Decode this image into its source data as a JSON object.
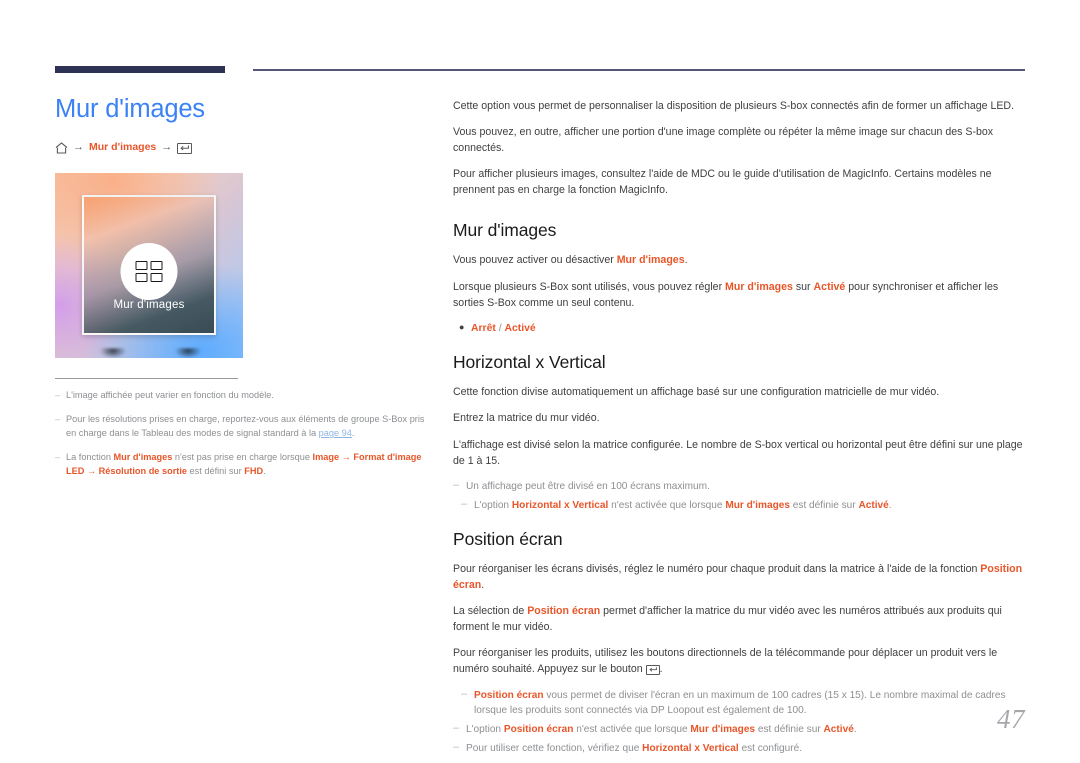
{
  "document": {
    "page_number": "47",
    "accent_color": "#e8562a",
    "title_color": "#3b82f6",
    "rule_color": "#2e3356"
  },
  "left": {
    "page_title": "Mur d'images",
    "breadcrumb": {
      "home_icon": "home-icon",
      "arrow": "→",
      "item": "Mur d'images",
      "enter_icon": "enter-key-icon"
    },
    "thumbnail": {
      "label": "Mur d'images",
      "icon": "four-panel-grid-icon"
    },
    "footnotes": [
      {
        "dash": "–",
        "parts": [
          {
            "text": "L'image affichée peut varier en fonction du modèle.",
            "style": "grey"
          }
        ]
      },
      {
        "dash": "–",
        "parts": [
          {
            "text": "Pour les résolutions prises en charge, reportez-vous aux éléments de groupe S-Box pris en charge dans le Tableau des modes de signal standard à la ",
            "style": "grey"
          },
          {
            "text": "page 94",
            "style": "link"
          },
          {
            "text": ".",
            "style": "grey"
          }
        ]
      },
      {
        "dash": "–",
        "parts": [
          {
            "text": "La fonction ",
            "style": "grey"
          },
          {
            "text": "Mur d'images",
            "style": "accent"
          },
          {
            "text": " n'est pas prise en charge lorsque ",
            "style": "grey"
          },
          {
            "text": "Image",
            "style": "accent"
          },
          {
            "text": " → ",
            "style": "accent"
          },
          {
            "text": "Format d'image LED",
            "style": "accent"
          },
          {
            "text": " → ",
            "style": "accent"
          },
          {
            "text": "Résolution de sortie",
            "style": "accent"
          },
          {
            "text": " est défini sur ",
            "style": "grey"
          },
          {
            "text": "FHD",
            "style": "accent"
          },
          {
            "text": ".",
            "style": "grey"
          }
        ]
      }
    ]
  },
  "right": {
    "intro_paragraphs": [
      "Cette option vous permet de personnaliser la disposition de plusieurs S-box connectés afin de former un affichage LED.",
      "Vous pouvez, en outre, afficher une portion d'une image complète ou répéter la même image sur chacun des S-box connectés.",
      "Pour afficher plusieurs images, consultez l'aide de MDC ou le guide d'utilisation de MagicInfo. Certains modèles ne prennent pas en charge la fonction MagicInfo."
    ],
    "sections": [
      {
        "heading": "Mur d'images",
        "paragraphs": [
          [
            {
              "text": "Vous pouvez activer ou désactiver ",
              "style": "body"
            },
            {
              "text": "Mur d'images",
              "style": "accent"
            },
            {
              "text": ".",
              "style": "body"
            }
          ],
          [
            {
              "text": "Lorsque plusieurs S-Box sont utilisés, vous pouvez régler ",
              "style": "body"
            },
            {
              "text": "Mur d'images",
              "style": "accent"
            },
            {
              "text": " sur ",
              "style": "body"
            },
            {
              "text": "Activé",
              "style": "accent"
            },
            {
              "text": " pour synchroniser et afficher les sorties S-Box comme un seul contenu.",
              "style": "body"
            }
          ]
        ],
        "bullets": [
          [
            {
              "text": "Arrêt",
              "style": "accent"
            },
            {
              "text": " / ",
              "style": "grey"
            },
            {
              "text": "Activé",
              "style": "accent"
            }
          ]
        ],
        "notes": []
      },
      {
        "heading": "Horizontal x Vertical",
        "paragraphs": [
          [
            {
              "text": "Cette fonction divise automatiquement un affichage basé sur une configuration matricielle de mur vidéo.",
              "style": "body"
            }
          ],
          [
            {
              "text": "Entrez la matrice du mur vidéo.",
              "style": "body"
            }
          ],
          [
            {
              "text": "L'affichage est divisé selon la matrice configurée. Le nombre de S-box vertical ou horizontal peut être défini sur une plage de 1 à 15.",
              "style": "body"
            }
          ]
        ],
        "bullets": [],
        "notes": [
          {
            "indent": false,
            "parts": [
              {
                "text": "Un affichage peut être divisé en 100 écrans maximum.",
                "style": "grey"
              }
            ]
          },
          {
            "indent": true,
            "parts": [
              {
                "text": "L'option ",
                "style": "grey"
              },
              {
                "text": "Horizontal x Vertical",
                "style": "accent"
              },
              {
                "text": " n'est activée que lorsque ",
                "style": "grey"
              },
              {
                "text": "Mur d'images",
                "style": "accent"
              },
              {
                "text": " est définie sur ",
                "style": "grey"
              },
              {
                "text": "Activé",
                "style": "accent"
              },
              {
                "text": ".",
                "style": "grey"
              }
            ]
          }
        ]
      },
      {
        "heading": "Position écran",
        "paragraphs": [
          [
            {
              "text": "Pour réorganiser les écrans divisés, réglez le numéro pour chaque produit dans la matrice à l'aide de la fonction ",
              "style": "body"
            },
            {
              "text": "Position écran",
              "style": "accent"
            },
            {
              "text": ".",
              "style": "body"
            }
          ],
          [
            {
              "text": "La sélection de ",
              "style": "body"
            },
            {
              "text": "Position écran",
              "style": "accent"
            },
            {
              "text": " permet d'afficher la matrice du mur vidéo avec les numéros attribués aux produits qui forment le mur vidéo.",
              "style": "body"
            }
          ],
          [
            {
              "text": "Pour réorganiser les produits, utilisez les boutons directionnels de la télécommande pour déplacer un produit vers le numéro souhaité. Appuyez sur le bouton ",
              "style": "body"
            },
            {
              "text": "",
              "style": "enter-icon"
            },
            {
              "text": ".",
              "style": "body"
            }
          ]
        ],
        "bullets": [],
        "notes": [
          {
            "indent": true,
            "parts": [
              {
                "text": "Position écran",
                "style": "accent"
              },
              {
                "text": " vous permet de diviser l'écran en un maximum de 100 cadres (15 x 15). Le nombre maximal de cadres lorsque les produits sont connectés via DP Loopout est également de 100.",
                "style": "grey"
              }
            ]
          },
          {
            "indent": false,
            "parts": [
              {
                "text": "L'option ",
                "style": "grey"
              },
              {
                "text": "Position écran",
                "style": "accent"
              },
              {
                "text": " n'est activée que lorsque ",
                "style": "grey"
              },
              {
                "text": "Mur d'images",
                "style": "accent"
              },
              {
                "text": " est définie sur ",
                "style": "grey"
              },
              {
                "text": "Activé",
                "style": "accent"
              },
              {
                "text": ".",
                "style": "grey"
              }
            ]
          },
          {
            "indent": false,
            "parts": [
              {
                "text": "Pour utiliser cette fonction, vérifiez que ",
                "style": "grey"
              },
              {
                "text": "Horizontal x Vertical",
                "style": "accent"
              },
              {
                "text": " est configuré.",
                "style": "grey"
              }
            ]
          }
        ]
      }
    ]
  }
}
